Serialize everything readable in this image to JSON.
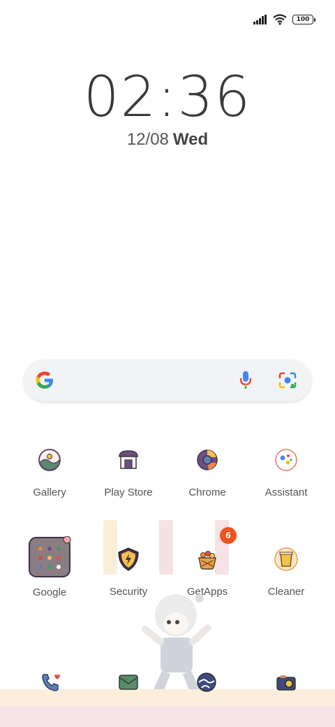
{
  "status_bar": {
    "battery_level": "100",
    "signal_icon": "cell-signal-icon",
    "wifi_icon": "wifi-icon"
  },
  "clock": {
    "time": "02:36"
  },
  "date": {
    "date": "12/08",
    "weekday": "Wed"
  },
  "search": {
    "logo_icon": "google-g-icon",
    "mic_icon": "microphone-icon",
    "lens_icon": "lens-camera-icon"
  },
  "apps_row1": [
    {
      "label": "Gallery",
      "icon": "gallery-icon"
    },
    {
      "label": "Play Store",
      "icon": "play-store-icon"
    },
    {
      "label": "Chrome",
      "icon": "chrome-icon"
    },
    {
      "label": "Assistant",
      "icon": "assistant-icon"
    }
  ],
  "apps_row2": [
    {
      "label": "Google",
      "icon": "google-folder-icon"
    },
    {
      "label": "Security",
      "icon": "security-icon"
    },
    {
      "label": "GetApps",
      "icon": "getapps-icon",
      "badge": "6"
    },
    {
      "label": "Cleaner",
      "icon": "cleaner-icon"
    }
  ],
  "dock": [
    {
      "icon": "phone-icon"
    },
    {
      "icon": "messages-icon"
    },
    {
      "icon": "browser-icon"
    },
    {
      "icon": "camera-icon"
    }
  ],
  "colors": {
    "badge": "#f0521d",
    "icon_purple": "#5e4a6e",
    "floor_cream": "#fbefdc",
    "floor_pink": "#f7e3e6"
  }
}
